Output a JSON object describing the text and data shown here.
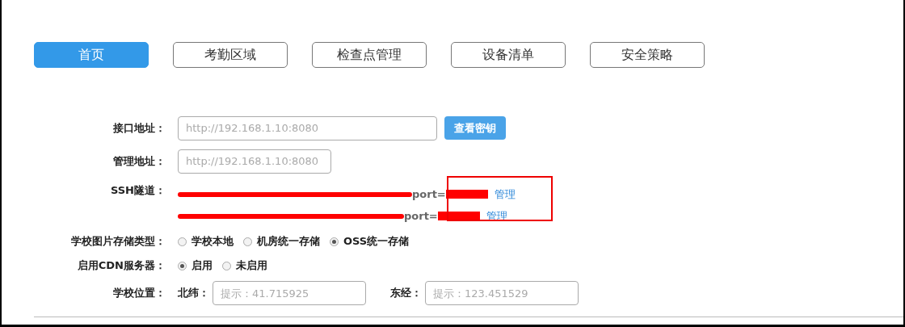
{
  "tabs": [
    {
      "label": "首页",
      "selected": true
    },
    {
      "label": "考勤区域",
      "selected": false
    },
    {
      "label": "检查点管理",
      "selected": false
    },
    {
      "label": "设备清单",
      "selected": false
    },
    {
      "label": "安全策略",
      "selected": false
    }
  ],
  "interface_address": {
    "label": "接口地址：",
    "placeholder": "http://192.168.1.10:8080",
    "button": "查看密钥"
  },
  "management_address": {
    "label": "管理地址：",
    "placeholder": "http://192.168.1.10:8080"
  },
  "ssh_tunnel": {
    "label": "SSH隧道：",
    "tunnels": [
      {
        "port_label": "port=",
        "link": "管理"
      },
      {
        "port_label": "port=",
        "link": "管理"
      }
    ]
  },
  "image_storage": {
    "label": "学校图片存储类型：",
    "options": [
      {
        "label": "学校本地",
        "selected": false
      },
      {
        "label": "机房统一存储",
        "selected": false
      },
      {
        "label": "OSS统一存储",
        "selected": true
      }
    ]
  },
  "cdn": {
    "label": "启用CDN服务器：",
    "options": [
      {
        "label": "启用",
        "selected": true
      },
      {
        "label": "未启用",
        "selected": false
      }
    ]
  },
  "location": {
    "label": "学校位置：",
    "latitude": {
      "label": "北纬：",
      "placeholder": "提示：41.715925"
    },
    "longitude": {
      "label": "东经：",
      "placeholder": "提示：123.451529"
    }
  }
}
